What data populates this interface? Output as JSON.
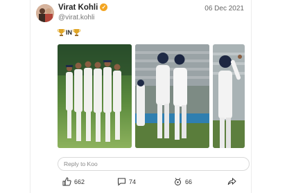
{
  "post": {
    "author_name": "Virat Kohli",
    "verified_icon": "verified-badge-icon",
    "handle": "@virat.kohli",
    "date": "06 Dec 2021",
    "text_middle": "IN",
    "text_icons": [
      "trophy-icon",
      "trophy-icon"
    ]
  },
  "media": [
    {
      "description_icon": "team-huddle-photo"
    },
    {
      "description_icon": "players-walking-photo"
    },
    {
      "description_icon": "player-celebrating-photo"
    }
  ],
  "reply": {
    "placeholder": "Reply to Koo"
  },
  "actions": {
    "likes": "662",
    "comments": "74",
    "rekoos": "66"
  },
  "colors": {
    "verified": "#f3a522",
    "field_green": "#5d8a3c",
    "jersey_white": "#f2f2f2"
  }
}
